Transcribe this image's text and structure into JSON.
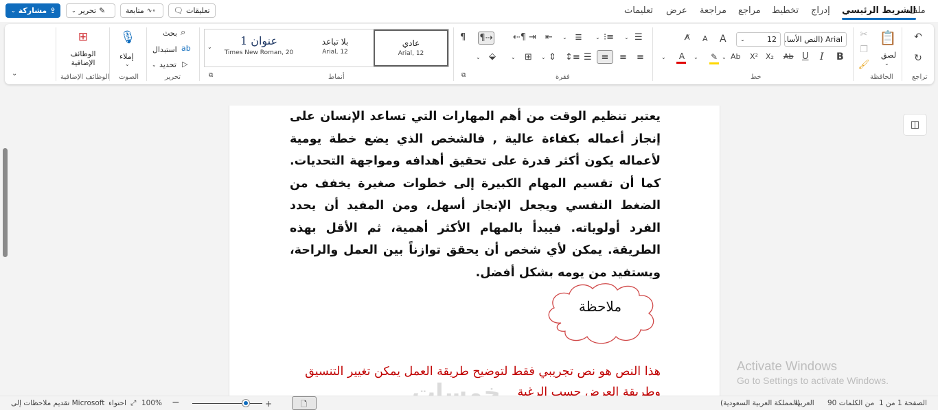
{
  "tabs": {
    "file": "ملف",
    "home": "الشريط الرئيسي",
    "insert": "إدراج",
    "layout": "تخطيط",
    "references": "مراجع",
    "review": "مراجعة",
    "view": "عرض",
    "help": "تعليمات"
  },
  "topbar": {
    "comments": "تعليقات",
    "follow": "متابعة",
    "edit": "تحرير",
    "share": "مشاركة"
  },
  "ribbon": {
    "undo_label": "تراجع",
    "clipboard": {
      "paste": "لصق",
      "label": "الحافظة"
    },
    "font": {
      "family": "Arial (النص الأسا...",
      "size": "12",
      "label": "خط",
      "bold": "B",
      "italic": "I",
      "underline": "U",
      "strike": "Ab",
      "subscript": "X₂",
      "superscript": "X²",
      "grow": "A",
      "shrink": "A",
      "highlight_color": "#ffd700",
      "font_color": "#e00000"
    },
    "paragraph": {
      "label": "فقرة",
      "pilcrow": "¶"
    },
    "styles": {
      "label": "أنماط",
      "items": [
        {
          "name": "عادي",
          "sub": "Arial, 12"
        },
        {
          "name": "بلا تباعد",
          "sub": "Arial, 12"
        },
        {
          "name": "عنوان 1",
          "sub": "Times New Roman, 20"
        }
      ]
    },
    "editing": {
      "find": "بحث",
      "replace": "استبدال",
      "select": "تحديد",
      "label": "تحرير"
    },
    "voice": {
      "dictate": "إملاء",
      "label": "الصوت"
    },
    "addins": {
      "name": "الوظائف الإضافية",
      "label": "الوظائف الإضافية"
    }
  },
  "document": {
    "paragraph": "يعتبر تنظيم الوقت من أهم المهارات التي تساعد الإنسان على إنجاز أعماله بكفاءة عالية , فالشخص الذي يضع خطة يومية لأعماله يكون أكثر قدرة على تحقيق أهدافه ومواجهة التحديات. كما أن تقسيم المهام الكبيرة إلى خطوات صغيرة يخفف من الضغط النفسي ويجعل الإنجاز أسهل،  ومن المفيد أن يحدد الفرد أولوياته. فيبدأ بالمهام الأكثر أهمية، ثم الأقل بهذه الطريقة. يمكن لأي شخص أن يحقق توازناً بين العمل والراحة، ويستفيد من يومه بشكل أفضل.",
    "cloud_text": "ملاحظة",
    "red_text": "هذا النص هو نص تجريبي فقط لتوضيح طريقة العمل يمكن تغيير التنسيق وطريقة العرض حسب الرغبة"
  },
  "activation": {
    "title": "Activate Windows",
    "subtitle": "Go to Settings to activate Windows."
  },
  "watermark": "خمسات",
  "status": {
    "page": "الصفحة 1 من 1",
    "words": "90 من الكلمات",
    "lang1": "العربية",
    "lang2": "(المملكة العربية السعودية)",
    "zoom": "100%",
    "focus": "احتواء",
    "feedback": "تقديم ملاحظات إلى Microsoft"
  }
}
